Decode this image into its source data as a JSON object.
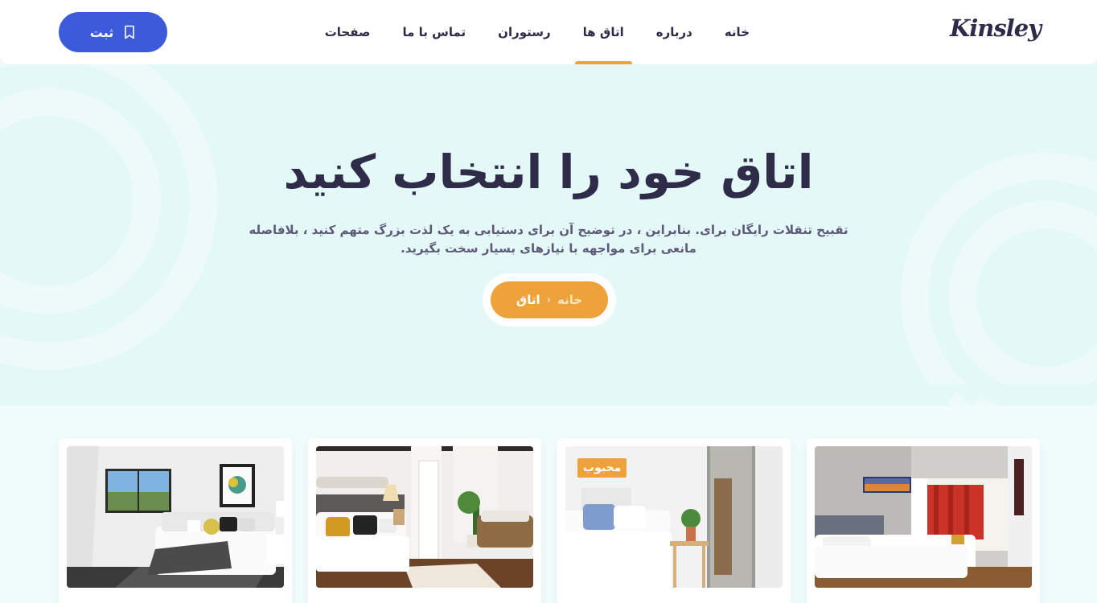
{
  "header": {
    "logo": "Kinsley",
    "nav": [
      {
        "label": "خانه",
        "active": false
      },
      {
        "label": "درباره",
        "active": false
      },
      {
        "label": "اتاق ها",
        "active": true
      },
      {
        "label": "رستوران",
        "active": false
      },
      {
        "label": "تماس با ما",
        "active": false
      },
      {
        "label": "صفحات",
        "active": false
      }
    ],
    "book_button": "ثبت",
    "book_icon": "bookmark-icon"
  },
  "hero": {
    "title": "اتاق خود را انتخاب کنید",
    "subtitle": "تقبیح تنقلات رایگان برای. بنابراین ، در توضیح آن برای دستیابی به یک لذت بزرگ متهم کنید ، بلافاصله مانعی برای مواجهه با نیازهای بسیار سخت بگیرید.",
    "breadcrumb": {
      "home": "خانه",
      "current": "اتاق",
      "separator_icon": "chevron-right-icon"
    }
  },
  "rooms": {
    "badge": "محبوب"
  },
  "colors": {
    "accent": "#eea23a",
    "primary": "#3b5bdb",
    "text_dark": "#2e2c48",
    "hero_bg": "#e5f8f8"
  }
}
